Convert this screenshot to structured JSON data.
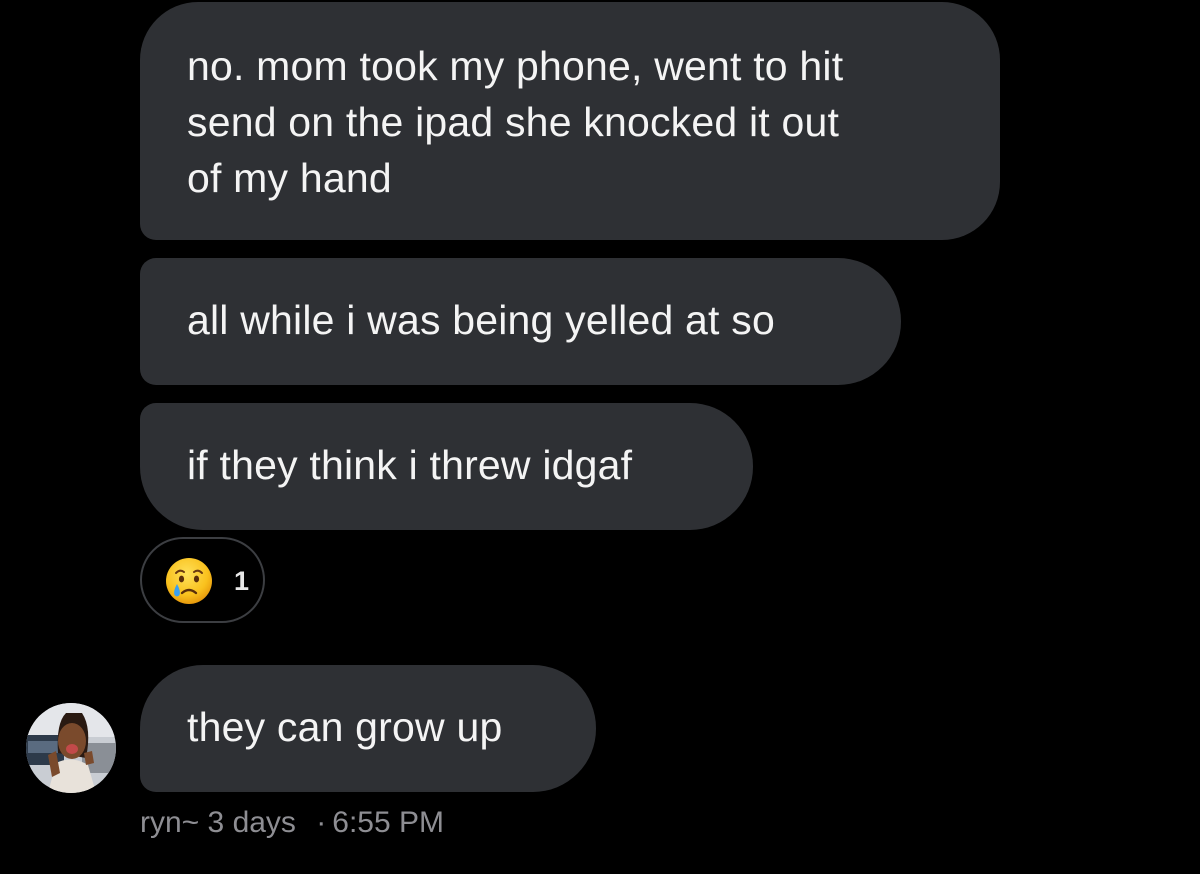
{
  "messages": [
    {
      "id": "msg-1",
      "lines": [
        "no. mom took my phone, went to hit",
        "send on the ipad she knocked it out",
        "of my hand"
      ]
    },
    {
      "id": "msg-2",
      "text": "all while i was being yelled at so"
    },
    {
      "id": "msg-3",
      "text": "if they think i threw idgaf"
    },
    {
      "id": "msg-4",
      "text": "they can grow up"
    }
  ],
  "reaction": {
    "emoji": "crying-face-icon",
    "count": "1"
  },
  "footer": {
    "username": "ryn~",
    "relative_time": "3 days",
    "separator": "·",
    "time": "6:55 PM"
  },
  "colors": {
    "background": "#000000",
    "bubble": "#2e3034",
    "text": "#f4f4f4",
    "meta": "#8e8e93"
  }
}
